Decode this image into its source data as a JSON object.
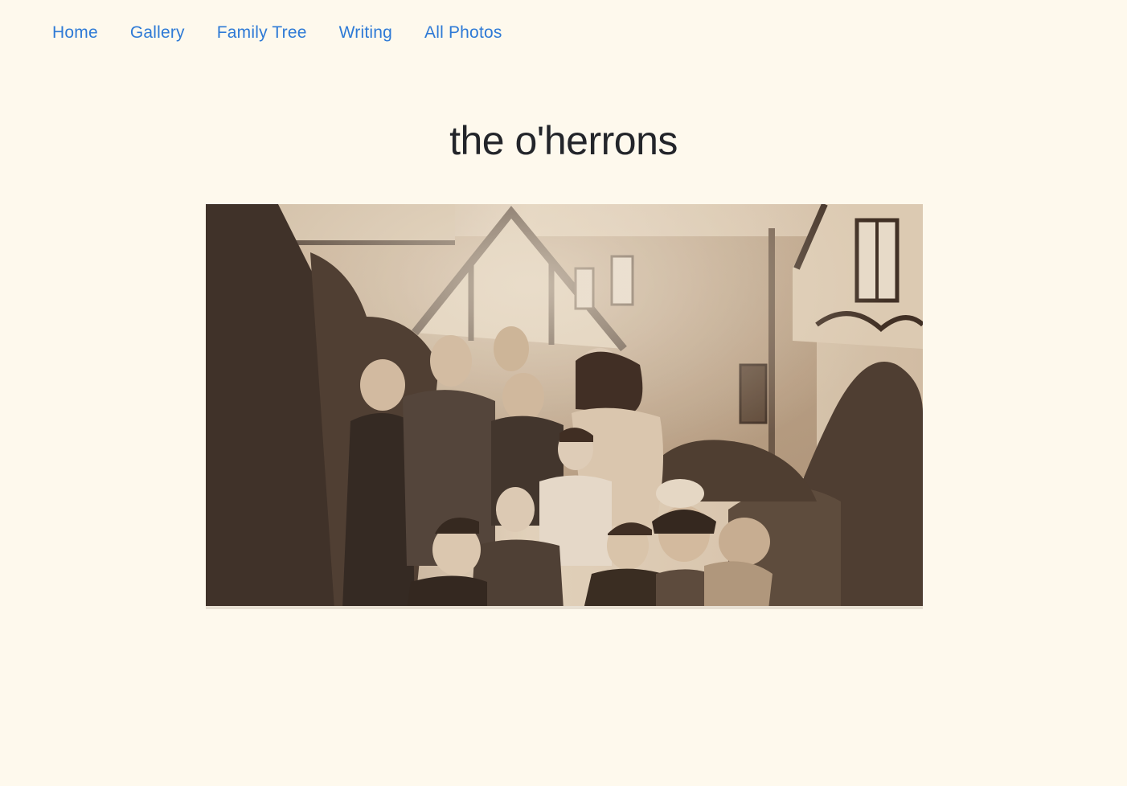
{
  "nav": {
    "items": [
      {
        "label": "Home"
      },
      {
        "label": "Gallery"
      },
      {
        "label": "Family Tree"
      },
      {
        "label": "Writing"
      },
      {
        "label": "All Photos"
      }
    ],
    "link_color": "#2e7ad6"
  },
  "page": {
    "title": "the o'herrons",
    "background": "#fef9ed"
  },
  "photo": {
    "description_icon": "family-photo",
    "alt": "the o'herrons"
  }
}
